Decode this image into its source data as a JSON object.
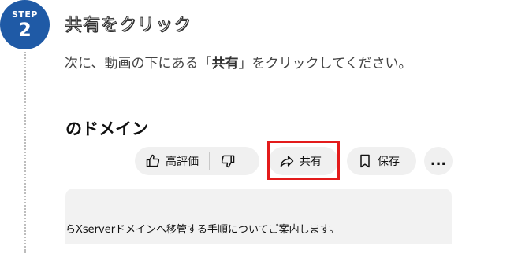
{
  "step": {
    "label": "STEP",
    "number": "2"
  },
  "title": "共有をクリック",
  "instruction": {
    "prefix": "次に、動画の下にある「",
    "highlight": "共有",
    "suffix": "」をクリックしてください。"
  },
  "screenshot": {
    "video_title_fragment": "のドメイン",
    "buttons": {
      "like_label": "高評価",
      "share_label": "共有",
      "save_label": "保存",
      "more_label": "..."
    },
    "description_fragment": "らXserverドメインへ移管する手順についてご案内します。"
  },
  "colors": {
    "badge": "#1f5aa6",
    "highlight_border": "#e31b1b"
  },
  "icons": [
    "thumbs-up-icon",
    "thumbs-down-icon",
    "share-arrow-icon",
    "bookmark-icon",
    "more-icon"
  ]
}
